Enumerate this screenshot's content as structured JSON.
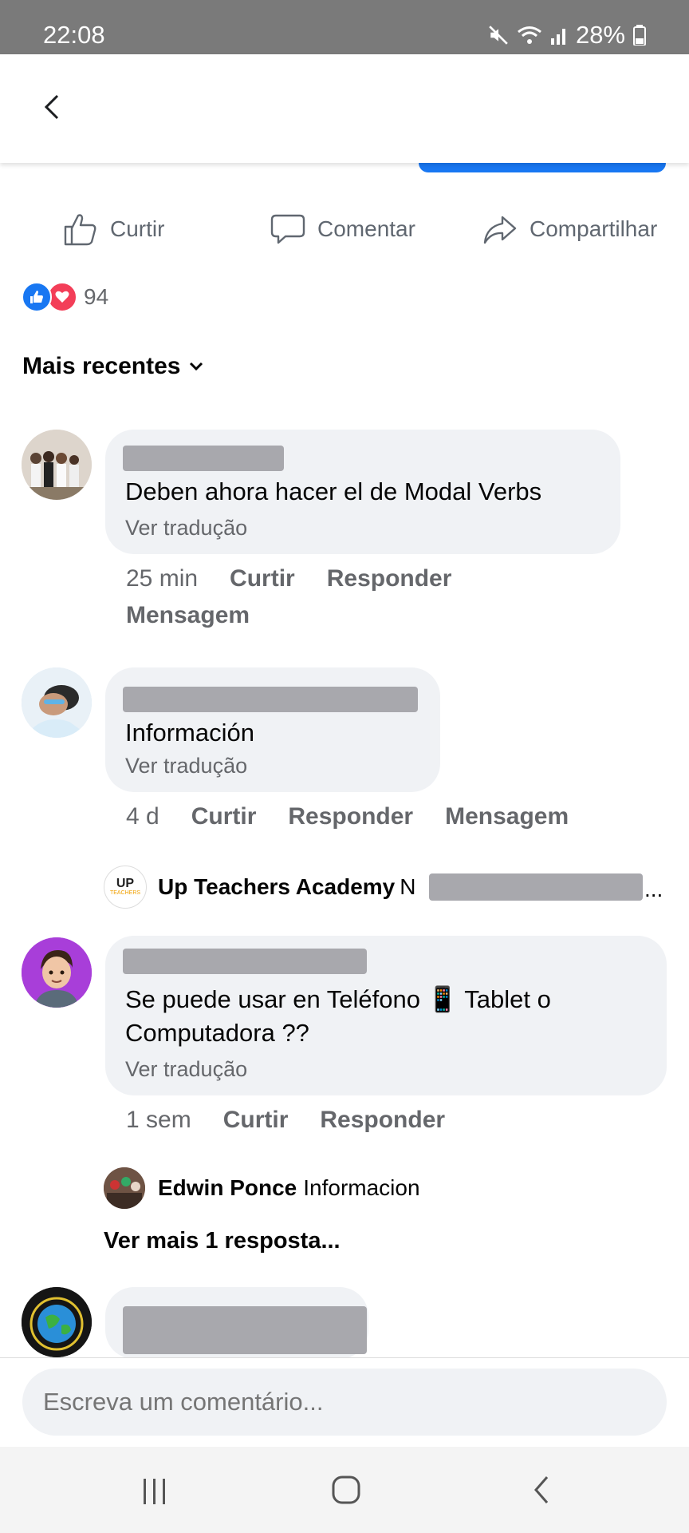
{
  "status": {
    "time": "22:08",
    "battery": "28%"
  },
  "actions": {
    "like": "Curtir",
    "comment": "Comentar",
    "share": "Compartilhar"
  },
  "reactions": {
    "count": "94"
  },
  "sort": {
    "label": "Mais recentes"
  },
  "comments": [
    {
      "text": "Deben ahora hacer el de Modal Verbs",
      "translate": "Ver tradução",
      "time": "25 min",
      "like": "Curtir",
      "reply": "Responder",
      "message": "Mensagem"
    },
    {
      "text": "Información",
      "translate": "Ver tradução",
      "time": "4 d",
      "like": "Curtir",
      "reply": "Responder",
      "message": "Mensagem",
      "reply_preview": {
        "author": "Up Teachers Academy",
        "author_suffix": "N",
        "ellipsis": "...",
        "logo_text": "UP",
        "logo_sub": "TEACHERS"
      }
    },
    {
      "text_line1": "Se puede usar en Teléfono 📱 Tablet o",
      "text_line2": "Computadora ??",
      "translate": "Ver tradução",
      "time": "1 sem",
      "like": "Curtir",
      "reply": "Responder",
      "reply_preview": {
        "author": "Edwin Ponce",
        "text": "Informacion"
      },
      "more_replies": "Ver mais 1 resposta..."
    }
  ],
  "input": {
    "placeholder": "Escreva um comentário..."
  },
  "icons": {
    "like": "thumbs-up-icon",
    "comment": "speech-bubble-icon",
    "share": "share-arrow-icon",
    "back": "chevron-left-icon",
    "sort": "chevron-down-icon"
  },
  "colors": {
    "brand": "#1877f2",
    "love": "#f33e58",
    "text_secondary": "#65676b"
  }
}
